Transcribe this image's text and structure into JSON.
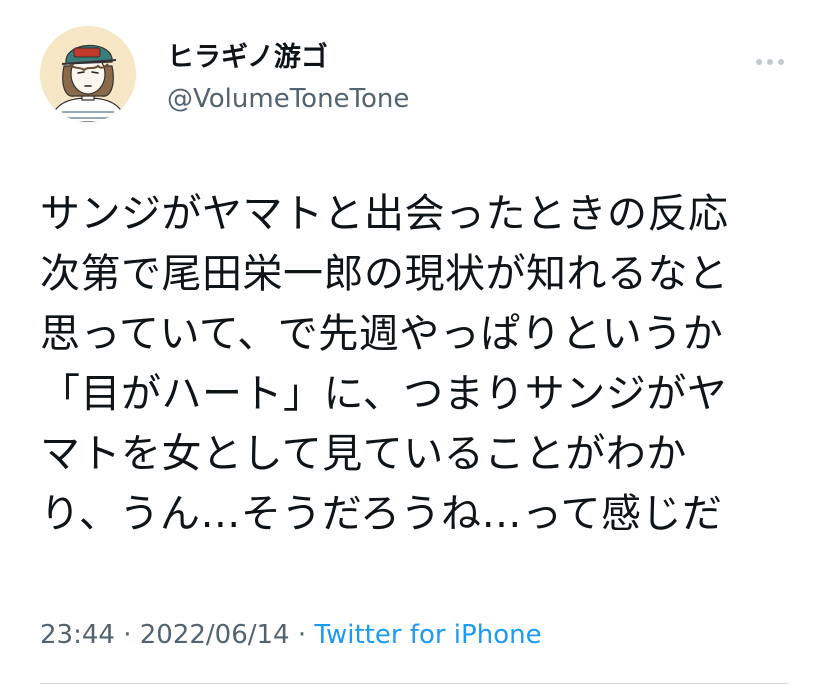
{
  "author": {
    "display_name": "ヒラギノ游ゴ",
    "handle": "@VolumeToneTone",
    "avatar_icon": "illustrated-avatar-with-cap"
  },
  "more_icon": "ellipsis-icon",
  "tweet": {
    "lines": [
      "サンジがヤマトと出会ったときの反応",
      "次第で尾田栄一郎の現状が知れるなと",
      "思っていて、で先週やっぱりというか",
      "「目がハート」に、つまりサンジがヤ",
      "マトを女として見ていることがわか",
      "り、うん…そうだろうね…って感じだ"
    ]
  },
  "meta": {
    "time": "23:44",
    "separator_1": " · ",
    "date": "2022/06/14",
    "separator_2": " · ",
    "source": "Twitter for iPhone"
  },
  "colors": {
    "text": "#0f1419",
    "secondary": "#536471",
    "link": "#1d9bf0",
    "divider": "#cfd9de"
  }
}
